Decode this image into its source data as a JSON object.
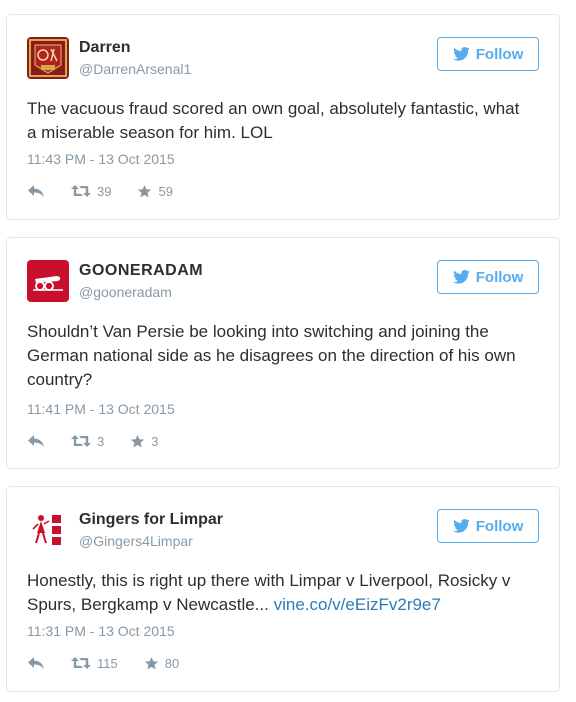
{
  "tweets": [
    {
      "name": "Darren",
      "handle": "@DarrenArsenal1",
      "follow_label": "Follow",
      "text": "The vacuous fraud scored an own goal, absolutely fantastic, what a miserable season for him. LOL",
      "link": "",
      "timestamp": "11:43 PM - 13 Oct 2015",
      "retweets": "39",
      "favorites": "59"
    },
    {
      "name": "GOONERADAM",
      "handle": "@gooneradam",
      "follow_label": "Follow",
      "text": "Shouldn’t Van Persie be looking into switching and joining the German national side as he disagrees on the direction of his own country?",
      "link": "",
      "timestamp": "11:41 PM - 13 Oct 2015",
      "retweets": "3",
      "favorites": "3"
    },
    {
      "name": "Gingers for Limpar",
      "handle": "@Gingers4Limpar",
      "follow_label": "Follow",
      "text": "Honestly, this is right up there with Limpar v Liverpool, Rosicky v Spurs, Bergkamp v Newcastle... ",
      "link": "vine.co/v/eEizFv2r9e7",
      "timestamp": "11:31 PM - 13 Oct 2015",
      "retweets": "115",
      "favorites": "80"
    }
  ],
  "icons": {
    "follow": "twitter-bird-icon",
    "reply": "reply-icon",
    "retweet": "retweet-icon",
    "favorite": "star-icon"
  },
  "colors": {
    "twitter_blue": "#55acee",
    "link": "#2b7bb9",
    "muted": "#8899a6",
    "arsenal_red": "#c8102e"
  }
}
